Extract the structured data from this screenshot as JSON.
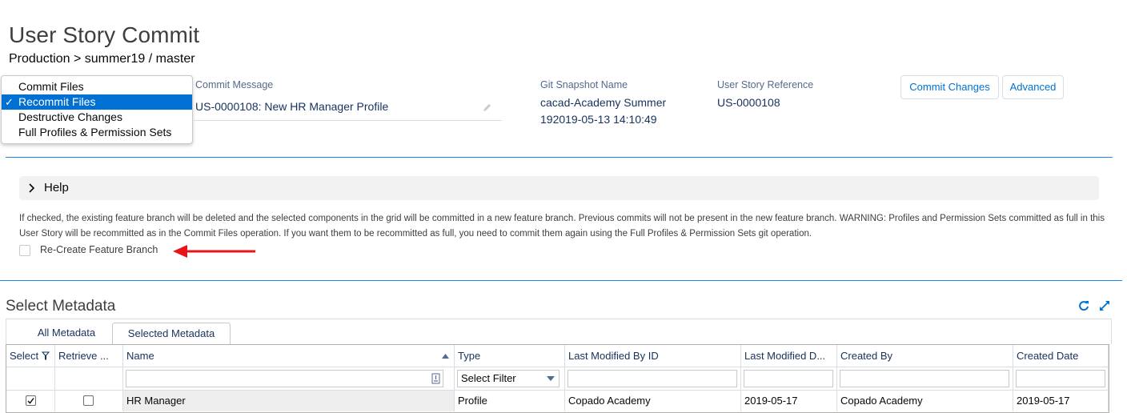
{
  "header": {
    "title": "User Story Commit",
    "breadcrumb": "Production > summer19 / master"
  },
  "operation_dropdown": {
    "items": [
      {
        "label": "Commit Files",
        "selected": false
      },
      {
        "label": "Recommit Files",
        "selected": true
      },
      {
        "label": "Destructive Changes",
        "selected": false
      },
      {
        "label": "Full Profiles & Permission Sets",
        "selected": false
      }
    ],
    "check_glyph": "✓"
  },
  "commit_message": {
    "label": "Commit Message",
    "value": "US-0000108: New HR Manager Profile"
  },
  "git_snapshot": {
    "label": "Git Snapshot Name",
    "value_line1": "cacad-Academy Summer",
    "value_line2": "192019-05-13 14:10:49"
  },
  "user_story_reference": {
    "label": "User Story Reference",
    "value": "US-0000108"
  },
  "buttons": {
    "commit_changes": "Commit Changes",
    "advanced": "Advanced"
  },
  "help": {
    "label": "Help",
    "text": "If checked, the existing feature branch will be deleted and the selected components in the grid will be committed in a new feature branch. Previous commits will not be present in the new feature branch. WARNING: Profiles and Permission Sets committed as full in this User Story will be recommitted as in the Commit Files operation. If you want them to be recommitted as full, you need to commit them again using the Full Profiles & Permission Sets git operation.",
    "checkbox_label": "Re-Create Feature Branch",
    "arrow_color": "#e8141c"
  },
  "metadata": {
    "title": "Select Metadata",
    "tabs": [
      "All Metadata",
      "Selected Metadata"
    ],
    "active_tab": 1,
    "columns": [
      "Select",
      "Retrieve ...",
      "Name",
      "Type",
      "Last Modified By ID",
      "Last Modified D...",
      "Created By",
      "Created Date"
    ],
    "type_filter": "Select Filter",
    "rows": [
      {
        "select": true,
        "retrieve": false,
        "name": "HR Manager",
        "type": "Profile",
        "last_modified_by": "Copado Academy",
        "last_modified_date": "2019-05-17",
        "created_by": "Copado Academy",
        "created_date": "2019-05-17"
      }
    ]
  },
  "colors": {
    "accent": "#0070d2",
    "divider": "#1589ee"
  }
}
